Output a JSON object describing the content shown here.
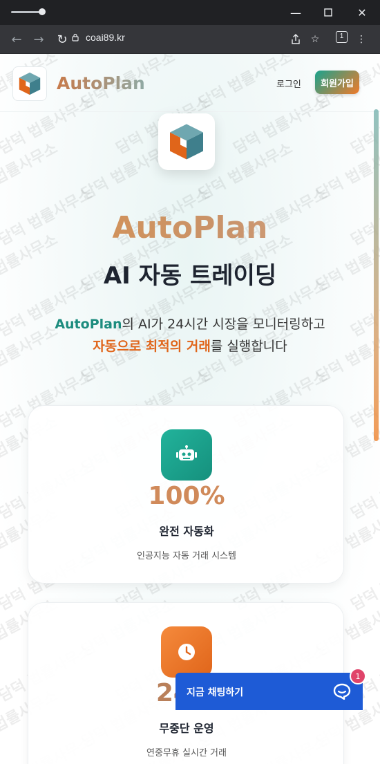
{
  "browser": {
    "url": "coai89.kr",
    "tab_count": "1"
  },
  "header": {
    "brand": "AutoPlan",
    "login_label": "로그인",
    "signup_label": "회원가입"
  },
  "hero": {
    "brand": "AutoPlan",
    "title": "AI 자동 트레이딩",
    "desc_line1_highlight": "AutoPlan",
    "desc_line1_rest": "의 AI가 24시간 시장을 모니터링하고",
    "desc_line2_highlight": "자동으로 최적의 거래",
    "desc_line2_rest": "를 실행합니다"
  },
  "cards": [
    {
      "icon": "robot-icon",
      "value": "100%",
      "label": "완전 자동화",
      "sub": "인공지능 자동 거래 시스템",
      "color": "#1aa38d"
    },
    {
      "icon": "clock-icon",
      "value": "24/7",
      "label": "무중단 운영",
      "sub": "연중무휴 실시간 거래",
      "color": "#f07a2a"
    }
  ],
  "watermark": "담덕 법률사무소",
  "chat": {
    "label": "지금 채팅하기",
    "badge": "1"
  },
  "colors": {
    "teal": "#1aa38d",
    "orange": "#f07a2a",
    "chat_blue": "#1e5bd6"
  }
}
